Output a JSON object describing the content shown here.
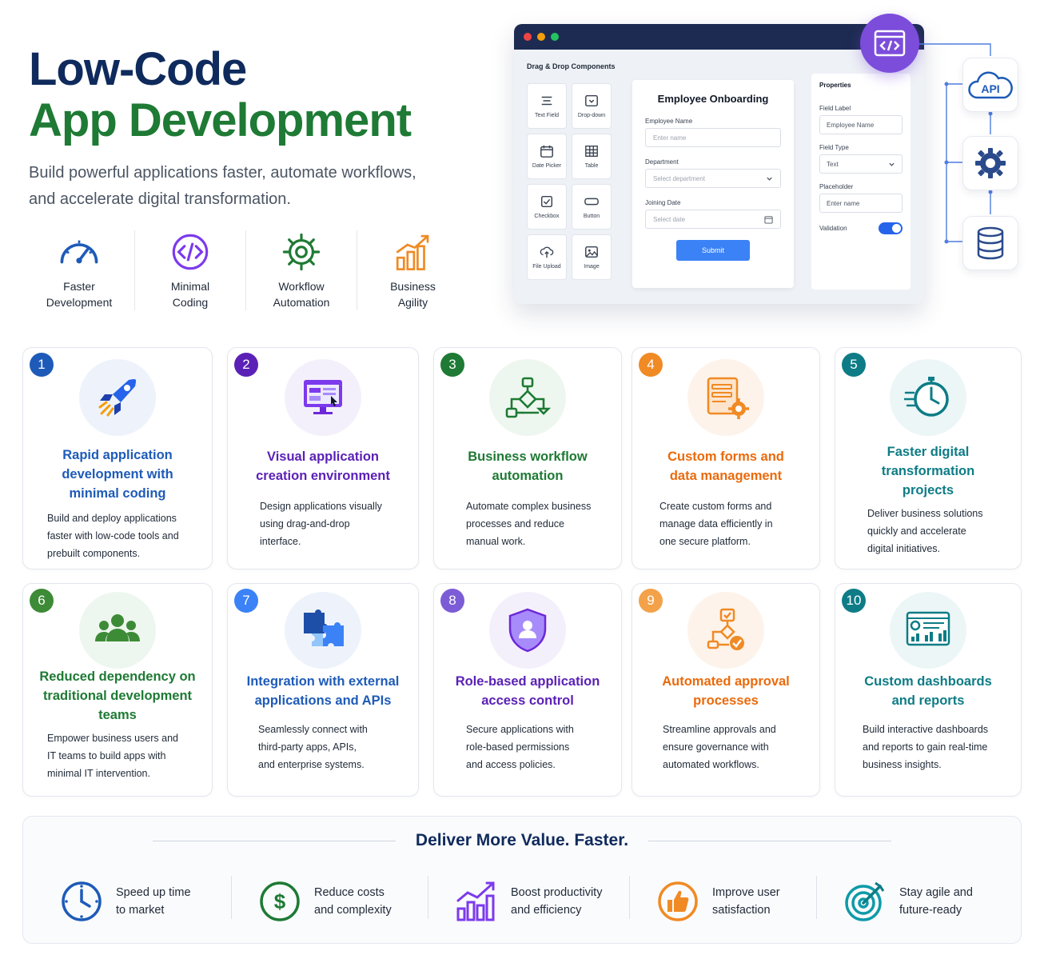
{
  "hero": {
    "title_line1": "Low-Code",
    "title_line2": "App Development",
    "subtitle": "Build powerful applications faster, automate workflows, and accelerate digital transformation."
  },
  "benefits": [
    {
      "label": "Faster\nDevelopment",
      "icon": "speedometer-icon"
    },
    {
      "label": "Minimal\nCoding",
      "icon": "code-icon"
    },
    {
      "label": "Workflow\nAutomation",
      "icon": "gear-icon"
    },
    {
      "label": "Business\nAgility",
      "icon": "growth-chart-icon"
    }
  ],
  "builder": {
    "palette_title": "Drag & Drop Components",
    "components": [
      "Text Field",
      "Drop-down",
      "Date Picker",
      "Table",
      "Checkbox",
      "Button",
      "File Upload",
      "Image"
    ],
    "form": {
      "title": "Employee Onboarding",
      "fields": [
        {
          "label": "Employee Name",
          "placeholder": "Enter name"
        },
        {
          "label": "Department",
          "placeholder": "Select department"
        },
        {
          "label": "Joining Date",
          "placeholder": "Select date"
        }
      ],
      "submit_label": "Submit"
    },
    "properties": {
      "title": "Properties",
      "field_label_label": "Field Label",
      "field_label_value": "Employee Name",
      "field_type_label": "Field Type",
      "field_type_value": "Text",
      "placeholder_label": "Placeholder",
      "placeholder_value": "Enter name",
      "validation_label": "Validation",
      "validation_on": true
    },
    "api_label": "API"
  },
  "features": [
    {
      "num": "1",
      "title": "Rapid application\ndevelopment with\nminimal coding",
      "desc": "Build and deploy applications\nfaster with low-code tools and\nprebuilt components.",
      "color": "#1e5bb8",
      "icon": "rocket-icon"
    },
    {
      "num": "2",
      "title": "Visual application\ncreation environment",
      "desc": "Design applications visually\nusing drag-and-drop\ninterface.",
      "color": "#5b21b6",
      "icon": "monitor-builder-icon"
    },
    {
      "num": "3",
      "title": "Business workflow\nautomation",
      "desc": "Automate complex business\nprocesses and reduce\nmanual work.",
      "color": "#1e7a34",
      "icon": "workflow-icon"
    },
    {
      "num": "4",
      "title": "Custom forms and\ndata management",
      "desc": "Create custom forms and\nmanage data efficiently in\none secure platform.",
      "color": "#ea6a0c",
      "icon": "form-gear-icon"
    },
    {
      "num": "5",
      "title": "Faster digital\ntransformation\nprojects",
      "desc": "Deliver business solutions\nquickly and accelerate\ndigital initiatives.",
      "color": "#0e7c86",
      "icon": "stopwatch-icon"
    },
    {
      "num": "6",
      "title": "Reduced dependency on\ntraditional development\nteams",
      "desc": "Empower business users and\nIT teams to build apps with\nminimal IT intervention.",
      "color": "#1e7a34",
      "icon": "team-icon"
    },
    {
      "num": "7",
      "title": "Integration with external\napplications and APIs",
      "desc": "Seamlessly connect with\nthird-party apps, APIs,\nand enterprise systems.",
      "color": "#1e5bb8",
      "icon": "puzzle-icon"
    },
    {
      "num": "8",
      "title": "Role-based application\naccess control",
      "desc": "Secure applications with\nrole-based permissions\nand access policies.",
      "color": "#5b21b6",
      "icon": "shield-user-icon"
    },
    {
      "num": "9",
      "title": "Automated approval\nprocesses",
      "desc": "Streamline approvals and\nensure governance with\nautomated workflows.",
      "color": "#ea6a0c",
      "icon": "approval-icon"
    },
    {
      "num": "10",
      "title": "Custom dashboards\nand reports",
      "desc": "Build interactive dashboards\nand reports to gain real-time\nbusiness insights.",
      "color": "#0e7c86",
      "icon": "dashboard-icon"
    }
  ],
  "footer": {
    "title": "Deliver More Value. Faster.",
    "items": [
      {
        "label": "Speed up time\nto market",
        "icon": "clock-icon"
      },
      {
        "label": "Reduce costs\nand complexity",
        "icon": "dollar-icon"
      },
      {
        "label": "Boost productivity\nand efficiency",
        "icon": "bar-growth-icon"
      },
      {
        "label": "Improve user\nsatisfaction",
        "icon": "thumbs-up-icon"
      },
      {
        "label": "Stay agile and\nfuture-ready",
        "icon": "target-icon"
      }
    ]
  }
}
